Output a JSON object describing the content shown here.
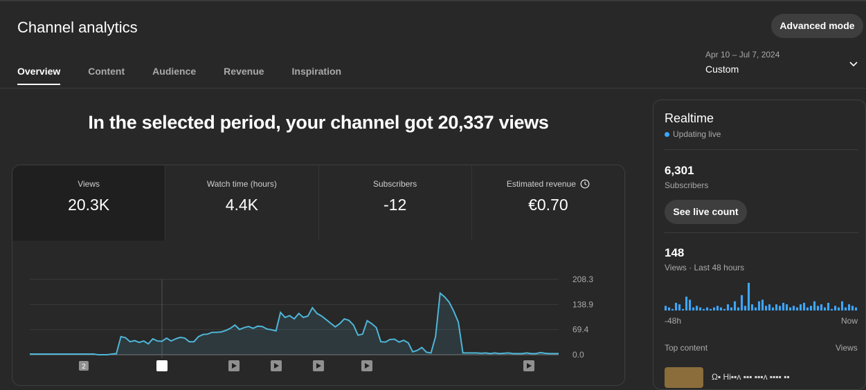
{
  "header": {
    "title": "Channel analytics",
    "advanced_button": "Advanced mode",
    "tabs": [
      {
        "label": "Overview",
        "active": true
      },
      {
        "label": "Content"
      },
      {
        "label": "Audience"
      },
      {
        "label": "Revenue"
      },
      {
        "label": "Inspiration"
      }
    ],
    "date_range": {
      "dates": "Apr 10 – Jul 7, 2024",
      "label": "Custom"
    }
  },
  "headline": "In the selected period, your channel got 20,337 views",
  "metrics": [
    {
      "label": "Views",
      "value": "20.3K"
    },
    {
      "label": "Watch time (hours)",
      "value": "4.4K"
    },
    {
      "label": "Subscribers",
      "value": "-12"
    },
    {
      "label": "Estimated revenue",
      "value": "€0.70"
    }
  ],
  "chart_data": {
    "type": "area",
    "y_ticks": [
      "208.3",
      "138.9",
      "69.4",
      "0.0"
    ],
    "ylim": [
      0,
      208.3
    ],
    "values": [
      2,
      2,
      2,
      2,
      2,
      2,
      2,
      2,
      2,
      2,
      2,
      2,
      2,
      2,
      2,
      0,
      0,
      0,
      2,
      3,
      50,
      47,
      36,
      39,
      34,
      38,
      30,
      44,
      38,
      37,
      46,
      38,
      44,
      48,
      46,
      36,
      36,
      50,
      56,
      57,
      62,
      62,
      63,
      67,
      73,
      82,
      70,
      75,
      78,
      73,
      79,
      78,
      71,
      69,
      66,
      117,
      103,
      108,
      99,
      114,
      103,
      107,
      130,
      114,
      107,
      97,
      87,
      77,
      86,
      99,
      95,
      82,
      54,
      57,
      94,
      86,
      75,
      36,
      35,
      42,
      43,
      35,
      40,
      33,
      8,
      12,
      20,
      7,
      5,
      50,
      170,
      160,
      145,
      120,
      90,
      5,
      5,
      5,
      5,
      4,
      5,
      3,
      5,
      3,
      4,
      5,
      3,
      3,
      3,
      5,
      3,
      3,
      6,
      4,
      3,
      3,
      3
    ],
    "color": "#4fb6d8",
    "markers": [
      {
        "type": "badge",
        "label": "2"
      },
      {
        "type": "selected"
      },
      {
        "type": "video"
      },
      {
        "type": "video"
      },
      {
        "type": "video"
      },
      {
        "type": "video"
      },
      {
        "type": "video"
      }
    ]
  },
  "realtime": {
    "title": "Realtime",
    "status": "Updating live",
    "subscribers": {
      "value": "6,301",
      "label": "Subscribers",
      "button": "See live count"
    },
    "views": {
      "value": "148",
      "label": "Views · Last 48 hours"
    },
    "bars": [
      3,
      2,
      1,
      5,
      4,
      1,
      9,
      7,
      2,
      3,
      2,
      1,
      2,
      1,
      2,
      3,
      2,
      1,
      4,
      2,
      6,
      2,
      10,
      3,
      18,
      4,
      2,
      6,
      7,
      3,
      4,
      2,
      4,
      3,
      5,
      4,
      2,
      3,
      2,
      4,
      5,
      2,
      3,
      6,
      3,
      4,
      2,
      5,
      1,
      3,
      2,
      6,
      2,
      4,
      3,
      2
    ],
    "axis_left": "-48h",
    "axis_right": "Now",
    "top_content": {
      "label": "Top content",
      "metric": "Views",
      "first_title": "Ω▪ Hi▪▪ʌ ▪▪▪ ▪▪▪ʌ ▪▪▪▪ ▪▪"
    },
    "accent": "#3ea6ff"
  }
}
